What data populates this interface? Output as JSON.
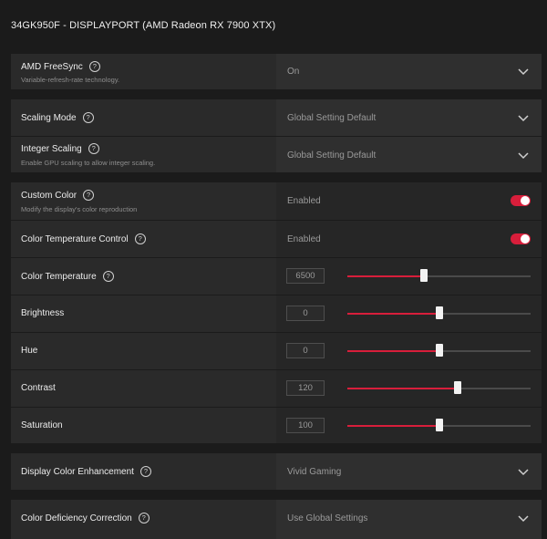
{
  "header": {
    "title": "34GK950F - DISPLAYPORT (AMD Radeon RX 7900 XTX)"
  },
  "icons": {
    "help": "help-circle-icon",
    "chevron": "chevron-down-icon"
  },
  "colors": {
    "accent": "#d81e3b",
    "panel": "#2a2a2a",
    "background": "#1b1b1b"
  },
  "freesync": {
    "label": "AMD FreeSync",
    "description": "Variable-refresh-rate technology.",
    "value": "On"
  },
  "scaling_mode": {
    "label": "Scaling Mode",
    "value": "Global Setting Default"
  },
  "integer_scaling": {
    "label": "Integer Scaling",
    "description": "Enable GPU scaling to allow integer scaling.",
    "value": "Global Setting Default"
  },
  "custom_color": {
    "label": "Custom Color",
    "description": "Modify the display's color reproduction",
    "status": "Enabled",
    "enabled": true
  },
  "color_temp_control": {
    "label": "Color Temperature Control",
    "status": "Enabled",
    "enabled": true
  },
  "color_temperature": {
    "label": "Color Temperature",
    "value": "6500",
    "fraction": 0.42
  },
  "brightness": {
    "label": "Brightness",
    "value": "0",
    "fraction": 0.5
  },
  "hue": {
    "label": "Hue",
    "value": "0",
    "fraction": 0.5
  },
  "contrast": {
    "label": "Contrast",
    "value": "120",
    "fraction": 0.6
  },
  "saturation": {
    "label": "Saturation",
    "value": "100",
    "fraction": 0.5
  },
  "display_color_enhancement": {
    "label": "Display Color Enhancement",
    "value": "Vivid Gaming"
  },
  "color_deficiency": {
    "label": "Color Deficiency Correction",
    "value": "Use Global Settings"
  }
}
